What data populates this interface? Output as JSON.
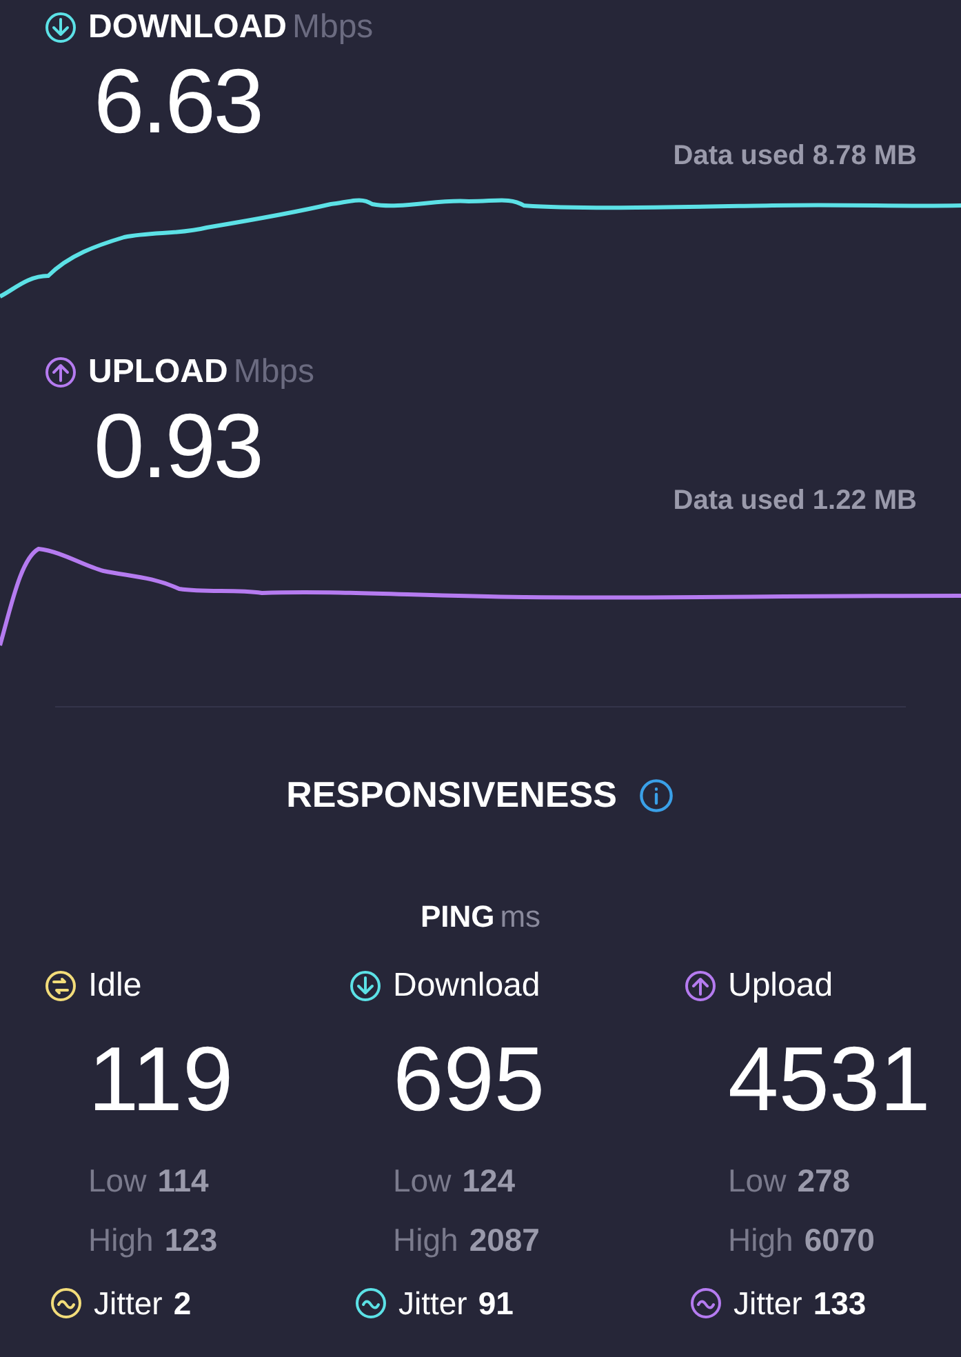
{
  "download": {
    "label": "DOWNLOAD",
    "unit": "Mbps",
    "value": "6.63",
    "data_used": "Data used 8.78 MB"
  },
  "upload": {
    "label": "UPLOAD",
    "unit": "Mbps",
    "value": "0.93",
    "data_used": "Data used 1.22 MB"
  },
  "responsiveness": {
    "title": "RESPONSIVENESS"
  },
  "ping": {
    "label": "PING",
    "unit": "ms",
    "columns": [
      {
        "kind": "idle",
        "label": "Idle",
        "value": "119",
        "low_label": "Low",
        "low": "114",
        "high_label": "High",
        "high": "123",
        "jitter_label": "Jitter",
        "jitter": "2"
      },
      {
        "kind": "download",
        "label": "Download",
        "value": "695",
        "low_label": "Low",
        "low": "124",
        "high_label": "High",
        "high": "2087",
        "jitter_label": "Jitter",
        "jitter": "91"
      },
      {
        "kind": "upload",
        "label": "Upload",
        "value": "4531",
        "low_label": "Low",
        "low": "278",
        "high_label": "High",
        "high": "6070",
        "jitter_label": "Jitter",
        "jitter": "133"
      }
    ]
  }
}
